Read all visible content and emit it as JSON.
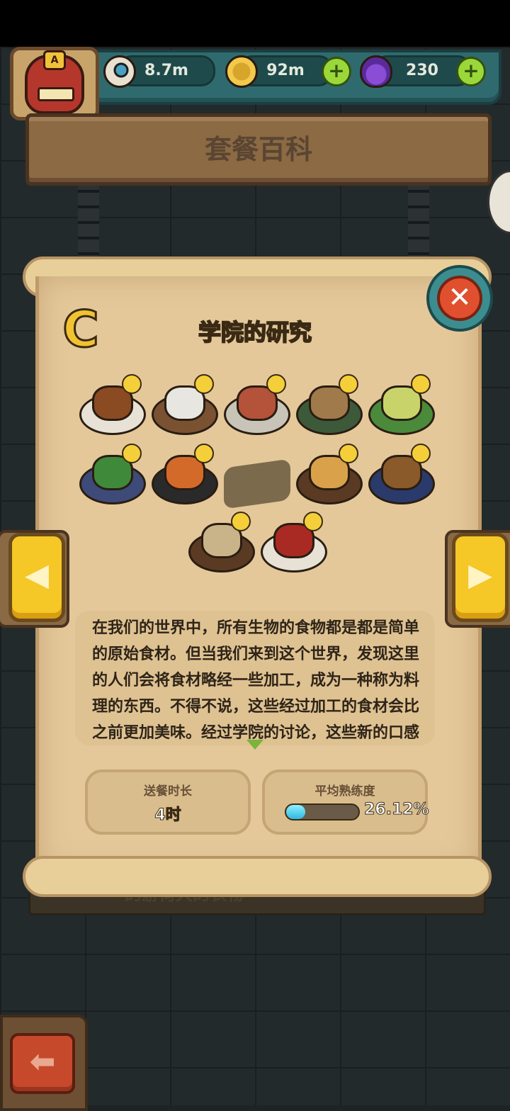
{
  "resources": {
    "eyes": "8.7m",
    "coins": "92m",
    "potions": "230",
    "avatar_badge": "A"
  },
  "page": {
    "title": "套餐百科"
  },
  "collection": {
    "grade": "C",
    "title": "学院的研究",
    "description": "在我们的世界中，所有生物的食物都是都是简单的原始食材。但当我们来到这个世界，发现这里的人们会将食材略经一些加工，成为一种称为料理的东西。不得不说，这些经过加工的食材会比之前更加美味。经过学院的讨论，这些新的口感需要被记载进入书阁中，首先需要",
    "dishes": [
      {
        "plate": "#e8e2d6",
        "food": "#8a4a22",
        "locked": false
      },
      {
        "plate": "#7a5232",
        "food": "#e8e6e0",
        "locked": false
      },
      {
        "plate": "#c9c4b8",
        "food": "#b4523a",
        "locked": false
      },
      {
        "plate": "#3c5a3a",
        "food": "#a07a4a",
        "locked": false
      },
      {
        "plate": "#4a8a3a",
        "food": "#c8d46a",
        "locked": false
      },
      {
        "plate": "#3e4a78",
        "food": "#3f8a3a",
        "locked": false
      },
      {
        "plate": "#2a2a2a",
        "food": "#d46a2a",
        "locked": false
      },
      {
        "plate": "#7b6a4c",
        "food": "#7b6a4c",
        "locked": true
      },
      {
        "plate": "#5a3a22",
        "food": "#d9a24a",
        "locked": false
      },
      {
        "plate": "#2a3a6a",
        "food": "#8a5a2a",
        "locked": false
      },
      {
        "plate": "#5a3a22",
        "food": "#c9b48a",
        "locked": false
      },
      {
        "plate": "#e8e2d6",
        "food": "#a82a22",
        "locked": false
      }
    ]
  },
  "stats": {
    "delivery_label": "送餐时长",
    "delivery_value": "4时",
    "proficiency_label": "平均熟练度",
    "proficiency_value": "26.12%",
    "proficiency_fraction": 0.2612
  },
  "under_text": "的游荷大的衣物",
  "colors": {
    "accent": "#f5c727",
    "close": "#e0502e",
    "progress": "#2fb8e0"
  }
}
